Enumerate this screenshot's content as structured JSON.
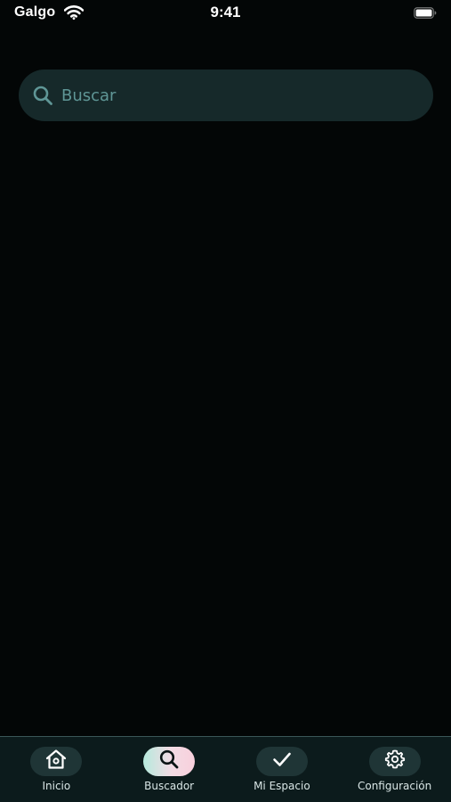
{
  "status_bar": {
    "carrier": "Galgo",
    "time": "9:41"
  },
  "search": {
    "placeholder": "Buscar",
    "value": ""
  },
  "tab_bar": {
    "tabs": [
      {
        "label": "Inicio",
        "icon": "home-icon",
        "active": false
      },
      {
        "label": "Buscador",
        "icon": "search-icon",
        "active": true
      },
      {
        "label": "Mi Espacio",
        "icon": "checkmark-icon",
        "active": false
      },
      {
        "label": "Configuración",
        "icon": "gear-icon",
        "active": false
      }
    ]
  },
  "colors": {
    "background": "#030606",
    "search_field": "#16292a",
    "search_accent": "#5f9696",
    "tab_bar": "#0c1b1c",
    "tab_pill": "#1f3536",
    "active_tab_gradient_start": "#b6eadd",
    "active_tab_gradient_end": "#f8d0dc"
  }
}
